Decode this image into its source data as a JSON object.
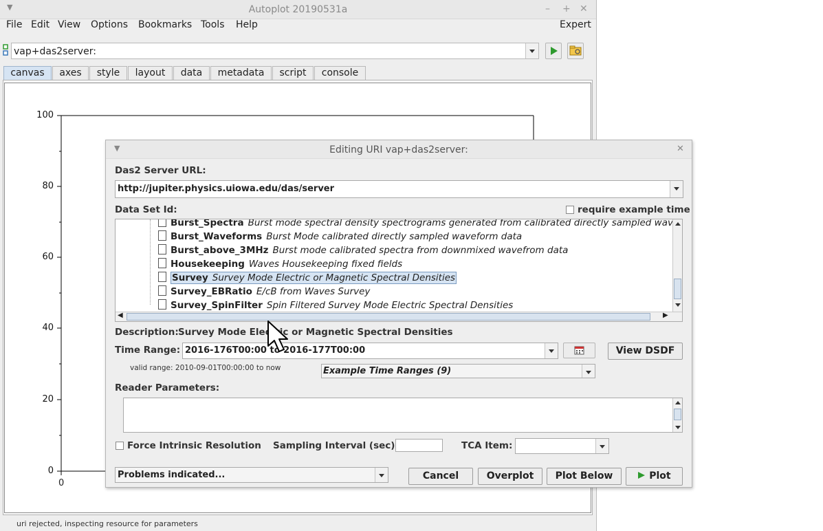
{
  "main": {
    "title": "Autoplot 20190531a",
    "menus": [
      "File",
      "Edit",
      "View",
      "Options",
      "Bookmarks",
      "Tools",
      "Help"
    ],
    "expert_label": "Expert",
    "uri_value": "vap+das2server:",
    "tabs": [
      "canvas",
      "axes",
      "style",
      "layout",
      "data",
      "metadata",
      "script",
      "console"
    ],
    "active_tab": "canvas",
    "status": "uri rejected, inspecting resource for parameters",
    "plot": {
      "y_ticks": [
        "100",
        "80",
        "60",
        "40",
        "20",
        "0"
      ],
      "x_ticks": [
        "0"
      ]
    }
  },
  "dialog": {
    "title": "Editing URI vap+das2server:",
    "server_label": "Das2 Server URL:",
    "server_value": "http://jupiter.physics.uiowa.edu/das/server",
    "dataset_label": "Data Set Id:",
    "require_example_time": "require example time",
    "tree_items": [
      {
        "name": "Burst_Spectra",
        "desc": "Burst mode spectral density spectrograms generated from calibrated directly sampled waveform da"
      },
      {
        "name": "Burst_Waveforms",
        "desc": "Burst Mode calibrated directly sampled waveform data"
      },
      {
        "name": "Burst_above_3MHz",
        "desc": "Burst mode calibrated spectra from downmixed wavefrom data"
      },
      {
        "name": "Housekeeping",
        "desc": "Waves Housekeeping fixed fields"
      },
      {
        "name": "Survey",
        "desc": "Survey Mode Electric or Magnetic Spectral Densities"
      },
      {
        "name": "Survey_EBRatio",
        "desc": "E/cB from Waves Survey"
      },
      {
        "name": "Survey_SpinFilter",
        "desc": "Spin Filtered Survey Mode Electric Spectral Densities"
      }
    ],
    "selected_item": "Survey",
    "description_label": "Description:",
    "description_value": "Survey Mode Electric or Magnetic Spectral Densities",
    "time_range_label": "Time Range:",
    "time_range_value": "2016-176T00:00 to 2016-177T00:00",
    "valid_range": "valid range: 2010-09-01T00:00:00 to now",
    "view_dsdf": "View DSDF",
    "example_time_ranges": "Example Time Ranges (9)",
    "reader_params_label": "Reader Parameters:",
    "reader_params_value": "",
    "force_intrinsic": "Force Intrinsic Resolution",
    "sampling_interval_label": "Sampling Interval (sec):",
    "sampling_interval_value": "",
    "tca_label": "TCA Item:",
    "tca_value": "",
    "problems": "Problems indicated...",
    "buttons": {
      "cancel": "Cancel",
      "overplot": "Overplot",
      "plot_below": "Plot Below",
      "plot": "Plot"
    }
  },
  "colors": {
    "selection": "#d6e4f3",
    "accent_green": "#2e9a2e",
    "window_bg": "#eeeeee"
  }
}
